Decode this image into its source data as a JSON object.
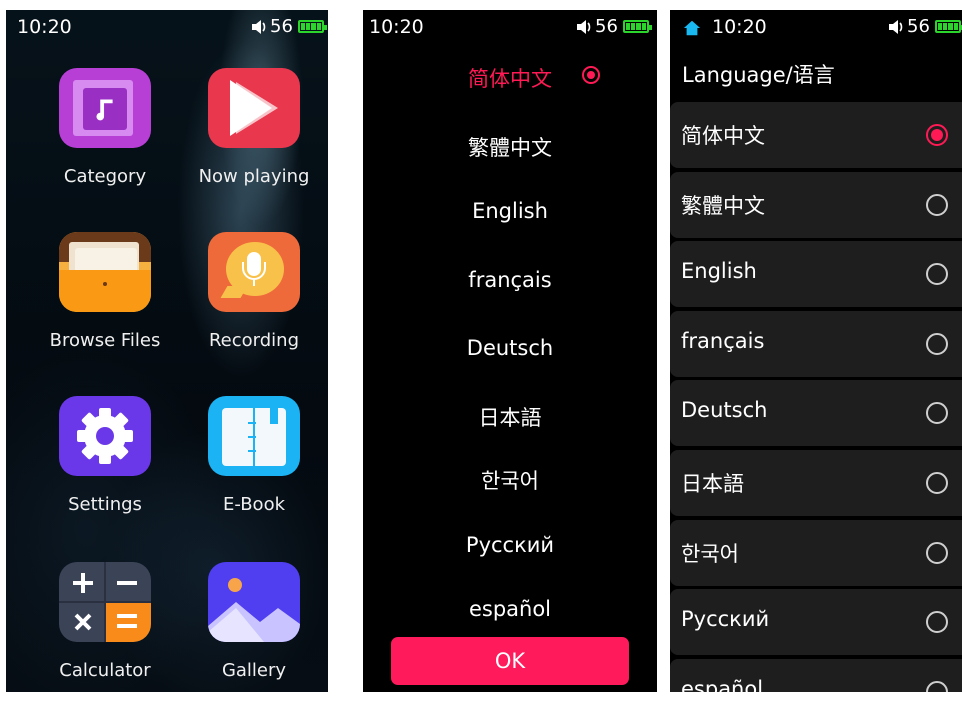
{
  "status": {
    "time": "10:20",
    "volume": "56"
  },
  "home": {
    "apps": [
      {
        "label": "Category"
      },
      {
        "label": "Now playing"
      },
      {
        "label": "Browse Files"
      },
      {
        "label": "Recording"
      },
      {
        "label": "Settings"
      },
      {
        "label": "E-Book"
      },
      {
        "label": "Calculator"
      },
      {
        "label": "Gallery"
      }
    ]
  },
  "picker": {
    "languages": [
      "简体中文",
      "繁體中文",
      "English",
      "français",
      "Deutsch",
      "日本語",
      "한국어",
      "Русский",
      "español"
    ],
    "selected_index": 0,
    "ok_label": "OK"
  },
  "settings_language": {
    "title": "Language/语言",
    "options": [
      "简体中文",
      "繁體中文",
      "English",
      "français",
      "Deutsch",
      "日本語",
      "한국어",
      "Русский",
      "español"
    ],
    "selected_index": 0
  },
  "colors": {
    "accent": "#ff1a55",
    "battery": "#2bd52b"
  }
}
